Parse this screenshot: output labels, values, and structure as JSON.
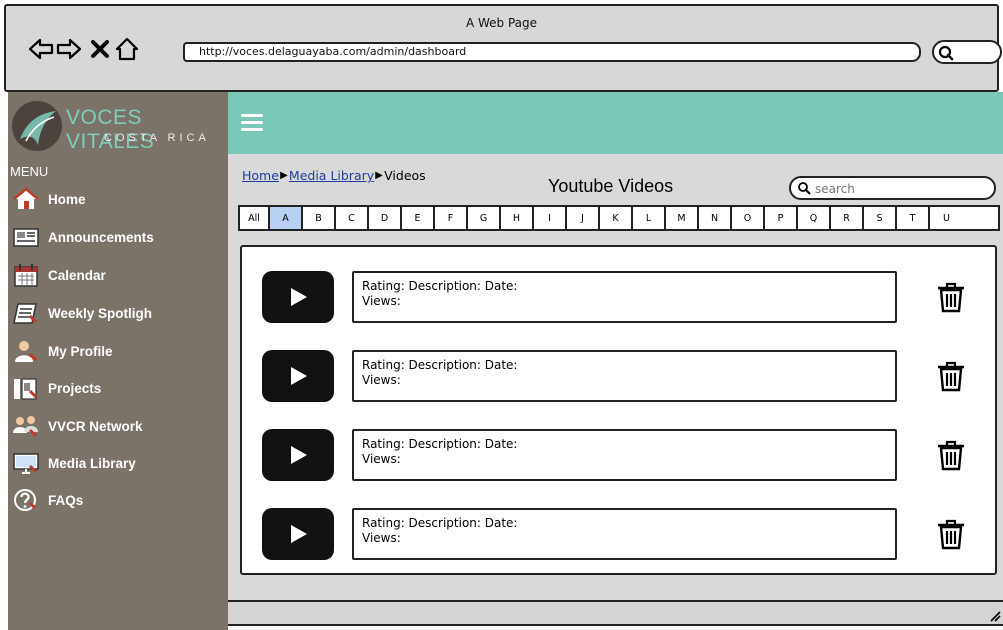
{
  "window": {
    "title": "A Web Page"
  },
  "browser": {
    "url": "http://voces.delaguayaba.com/admin/dashboard",
    "back_icon": "arrow-left-icon",
    "forward_icon": "arrow-right-icon",
    "close_icon": "close-icon",
    "home_icon": "home-icon"
  },
  "brand": {
    "name": "VOCES VITALES",
    "subtitle": "COSTA RICA",
    "accent": "#7ac9b8",
    "sidebar_bg": "#7b7268"
  },
  "sidebar": {
    "menu_label": "MENU",
    "items": [
      {
        "label": "Home",
        "icon": "house-icon"
      },
      {
        "label": "Announcements",
        "icon": "newspaper-icon"
      },
      {
        "label": "Calendar",
        "icon": "calendar-icon"
      },
      {
        "label": "Weekly Spotligh",
        "icon": "notebook-icon"
      },
      {
        "label": "My Profile",
        "icon": "user-icon"
      },
      {
        "label": "Projects",
        "icon": "folder-icon"
      },
      {
        "label": "VVCR Network",
        "icon": "group-icon"
      },
      {
        "label": "Media Library",
        "icon": "monitor-icon"
      },
      {
        "label": "FAQs",
        "icon": "question-icon"
      }
    ]
  },
  "breadcrumb": {
    "items": [
      "Home",
      "Media Library"
    ],
    "current": "Videos"
  },
  "page": {
    "title": "Youtube Videos"
  },
  "search": {
    "placeholder": "search"
  },
  "alphabet": {
    "selected": "A",
    "letters": [
      "All",
      "A",
      "B",
      "C",
      "D",
      "E",
      "F",
      "G",
      "H",
      "I",
      "J",
      "K",
      "L",
      "M",
      "N",
      "O",
      "P",
      "Q",
      "R",
      "S",
      "T",
      "U"
    ]
  },
  "videos": [
    {
      "line1": "Rating: Description: Date:",
      "line2": "Views:"
    },
    {
      "line1": "Rating: Description: Date:",
      "line2": "Views:"
    },
    {
      "line1": "Rating: Description: Date:",
      "line2": "Views:"
    },
    {
      "line1": "Rating: Description: Date:",
      "line2": "Views:"
    }
  ]
}
